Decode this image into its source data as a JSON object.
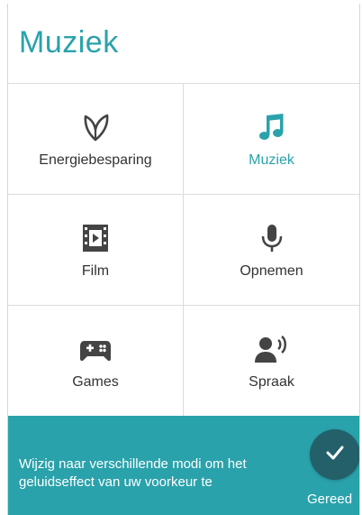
{
  "header": {
    "title": "Muziek"
  },
  "modes": [
    {
      "label": "Energiebesparing",
      "icon": "leaf-icon",
      "active": false
    },
    {
      "label": "Muziek",
      "icon": "music-note-icon",
      "active": true
    },
    {
      "label": "Film",
      "icon": "film-icon",
      "active": false
    },
    {
      "label": "Opnemen",
      "icon": "microphone-icon",
      "active": false
    },
    {
      "label": "Games",
      "icon": "gamepad-icon",
      "active": false
    },
    {
      "label": "Spraak",
      "icon": "speaking-person-icon",
      "active": false
    }
  ],
  "footer": {
    "hint": "Wijzig naar verschillende modi om het geluidseffect van uw voorkeur te",
    "done_label": "Gereed",
    "done_icon": "checkmark-icon"
  },
  "colors": {
    "accent": "#2aa2ab",
    "icon_gray": "#444444",
    "done_button": "#23606a"
  }
}
